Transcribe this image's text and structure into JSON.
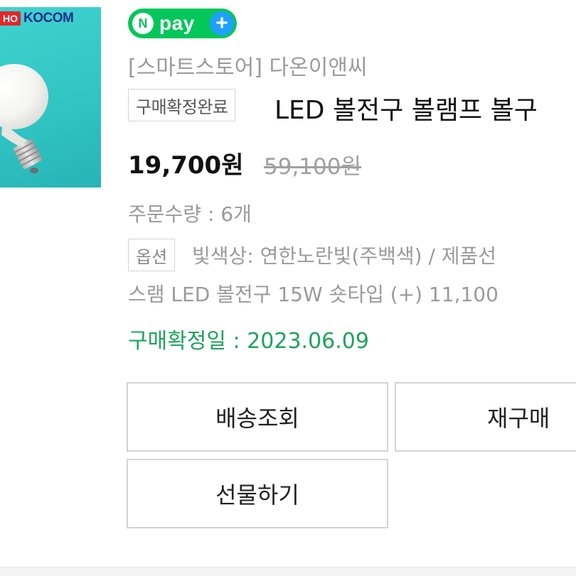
{
  "product": {
    "brand_part1": "HO",
    "brand_part2": "KOCOM",
    "pay_n": "N",
    "pay_label": "pay",
    "pay_plus": "+",
    "store": "[스마트스토어] 다온이앤씨",
    "status_badge": "구매확정완료",
    "title": "LED 볼전구 볼램프 볼구",
    "price": "19,700원",
    "original_price": "59,100원",
    "quantity": "주문수량 : 6개",
    "option_tag": "옵션",
    "option_line1": "빛색상: 연한노란빛(주백색) / 제품선",
    "option_line2": "스램 LED 볼전구 15W 숏타입 (+) 11,100",
    "confirm_date": "구매확정일 : 2023.06.09"
  },
  "actions": {
    "track_delivery": "배송조회",
    "rebuy": "재구매",
    "gift": "선물하기"
  },
  "colors": {
    "npay_green": "#03c75a",
    "confirm_green": "#1ea35a",
    "plus_blue": "#1fa0ff"
  }
}
